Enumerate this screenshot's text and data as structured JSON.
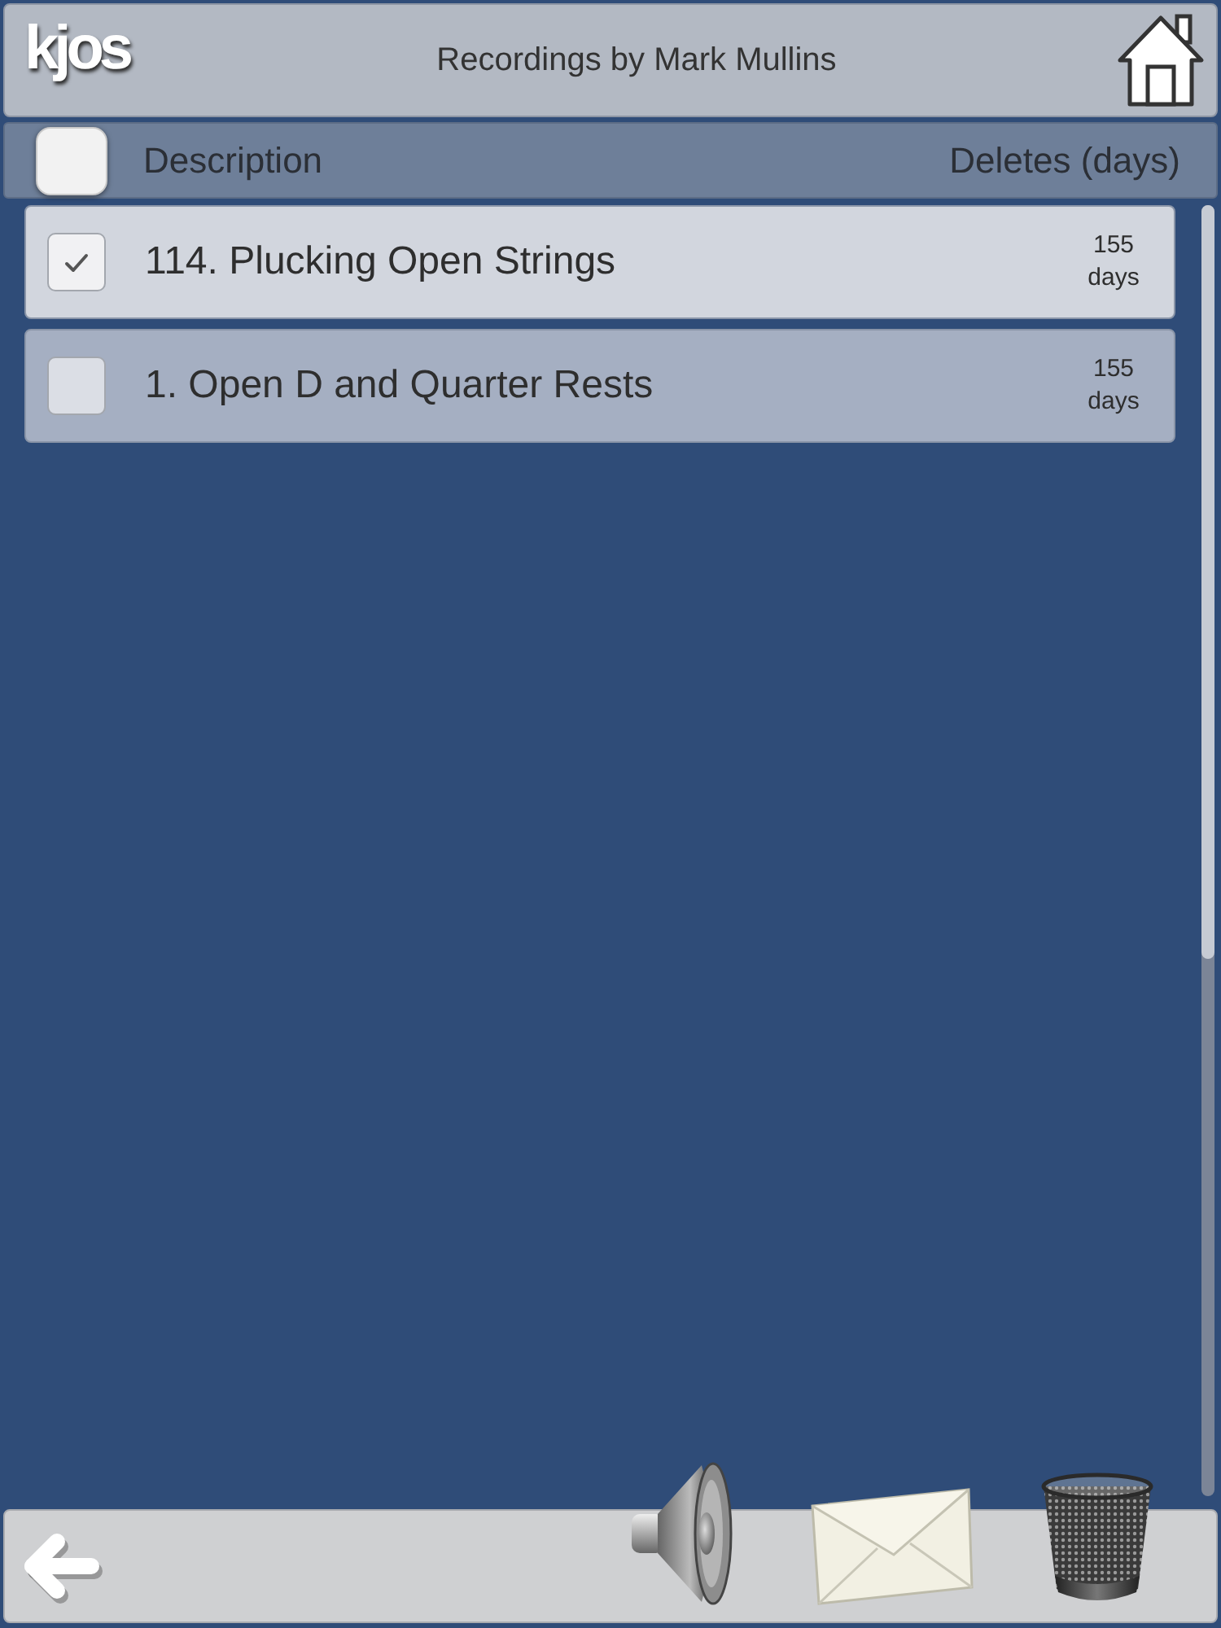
{
  "header": {
    "logo": "kjos",
    "title": "Recordings by Mark Mullins"
  },
  "list_header": {
    "select_all_checked": false,
    "columns": [
      "Description",
      "Deletes (days)"
    ]
  },
  "recordings": [
    {
      "description": "114. Plucking Open Strings",
      "deletes_in": "155 days",
      "checked": true
    },
    {
      "description": "1. Open D and Quarter Rests",
      "deletes_in": "155 days",
      "checked": false
    }
  ]
}
